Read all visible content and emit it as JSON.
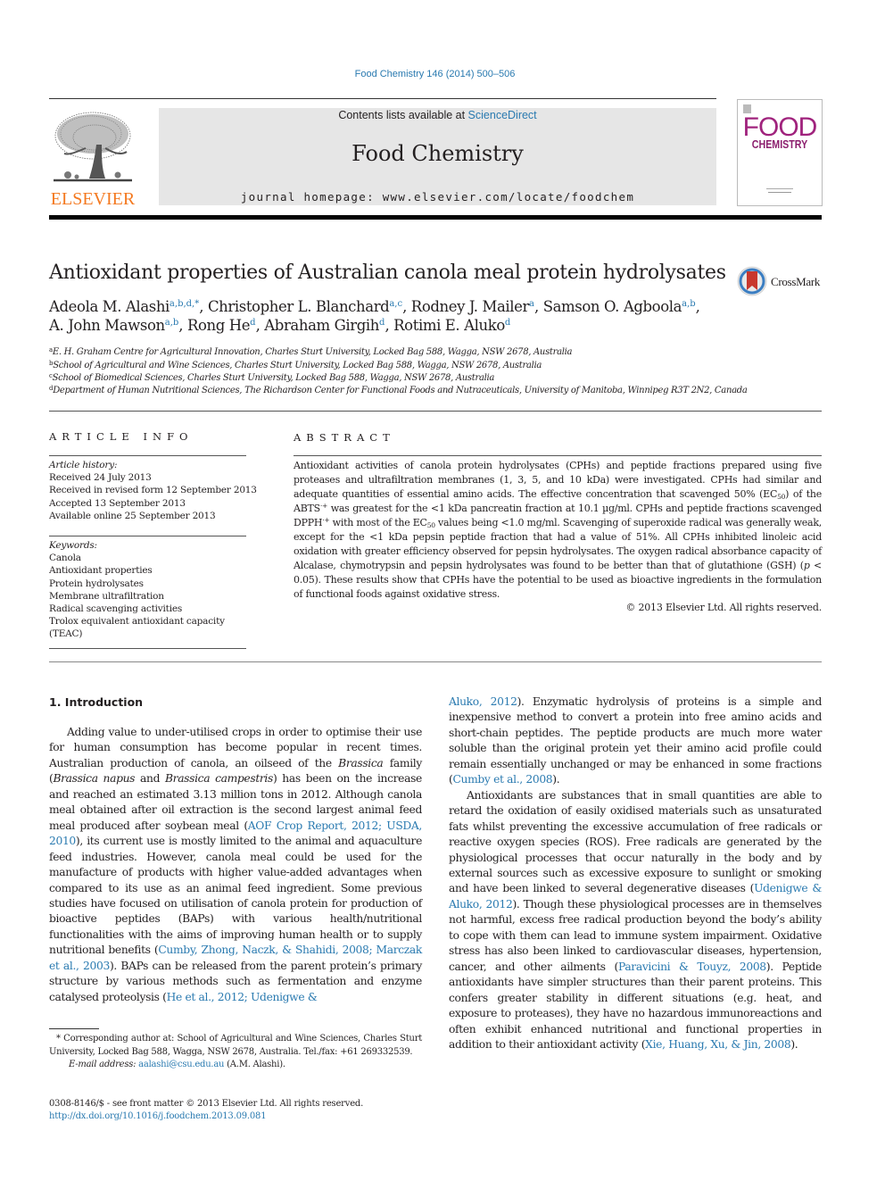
{
  "citation": "Food Chemistry 146 (2014) 500–506",
  "publisher": {
    "name": "ELSEVIER",
    "brand_color": "#f47920"
  },
  "masthead": {
    "contents_prefix": "Contents lists available at ",
    "contents_link": "ScienceDirect",
    "journal_name": "Food Chemistry",
    "homepage": "journal homepage: www.elsevier.com/locate/foodchem"
  },
  "cover": {
    "line1": "FOOD",
    "line2": "CHEMISTRY",
    "color": "#a0237d"
  },
  "crossmark": {
    "label": "CrossMark"
  },
  "title": "Antioxidant properties of Australian canola meal protein hydrolysates",
  "authors": [
    {
      "name": "Adeola M. Alashi",
      "aff": "a,b,d,*",
      "sep": ", "
    },
    {
      "name": "Christopher L. Blanchard",
      "aff": "a,c",
      "sep": ", "
    },
    {
      "name": "Rodney J. Mailer",
      "aff": "a",
      "sep": ", "
    },
    {
      "name": "Samson O. Agboola",
      "aff": "a,b",
      "sep": ","
    },
    {
      "name": "A. John Mawson",
      "aff": "a,b",
      "sep": ", "
    },
    {
      "name": "Rong He",
      "aff": "d",
      "sep": ", "
    },
    {
      "name": "Abraham Girgih",
      "aff": "d",
      "sep": ", "
    },
    {
      "name": "Rotimi E. Aluko",
      "aff": "d",
      "sep": ""
    }
  ],
  "affiliations": [
    {
      "key": "a",
      "text": "E. H. Graham Centre for Agricultural Innovation, Charles Sturt University, Locked Bag 588, Wagga, NSW 2678, Australia"
    },
    {
      "key": "b",
      "text": "School of Agricultural and Wine Sciences, Charles Sturt University, Locked Bag 588, Wagga, NSW 2678, Australia"
    },
    {
      "key": "c",
      "text": "School of Biomedical Sciences, Charles Sturt University, Locked Bag 588, Wagga, NSW 2678, Australia"
    },
    {
      "key": "d",
      "text": "Department of Human Nutritional Sciences, The Richardson Center for Functional Foods and Nutraceuticals, University of Manitoba, Winnipeg R3T 2N2, Canada"
    }
  ],
  "article_info": {
    "label": "ARTICLE INFO",
    "history_heading": "Article history:",
    "history": [
      "Received 24 July 2013",
      "Received in revised form 12 September 2013",
      "Accepted 13 September 2013",
      "Available online 25 September 2013"
    ],
    "keywords_heading": "Keywords:",
    "keywords": [
      "Canola",
      "Antioxidant properties",
      "Protein hydrolysates",
      "Membrane ultrafiltration",
      "Radical scavenging activities",
      "Trolox equivalent antioxidant capacity",
      "(TEAC)"
    ]
  },
  "abstract": {
    "label": "ABSTRACT",
    "segments": [
      {
        "t": "Antioxidant activities of canola protein hydrolysates (CPHs) and peptide fractions prepared using five proteases and ultrafiltration membranes (1, 3, 5, and 10 kDa) were investigated. CPHs had similar and adequate quantities of essential amino acids. The effective concentration that scavenged 50% (EC"
      },
      {
        "sub": "50"
      },
      {
        "t": ") of the ABTS"
      },
      {
        "sup": "·+"
      },
      {
        "t": " was greatest for the <1 kDa pancreatin fraction at 10.1 µg/ml. CPHs and peptide fractions scavenged DPPH"
      },
      {
        "sup": "·+"
      },
      {
        "t": " with most of the EC"
      },
      {
        "sub": "50"
      },
      {
        "t": " values being <1.0 mg/ml. Scavenging of superoxide radical was generally weak, except for the <1 kDa pepsin peptide fraction that had a value of 51%. All CPHs inhibited linoleic acid oxidation with greater efficiency observed for pepsin hydrolysates. The oxygen radical absorbance capacity of Alcalase, chymotrypsin and pepsin hydrolysates was found to be better than that of glutathione (GSH) ("
      },
      {
        "i": "p"
      },
      {
        "t": " < 0.05). These results show that CPHs have the potential to be used as bioactive ingredients in the formulation of functional foods against oxidative stress."
      }
    ],
    "copyright": "© 2013 Elsevier Ltd. All rights reserved."
  },
  "introduction": {
    "heading": "1. Introduction",
    "left_paragraph": [
      {
        "t": "Adding value to under-utilised crops in order to optimise their use for human consumption has become popular in recent times. Australian production of canola, an oilseed of the "
      },
      {
        "i": "Brassica"
      },
      {
        "t": " family ("
      },
      {
        "i": "Brassica napus"
      },
      {
        "t": " and "
      },
      {
        "i": "Brassica campestris"
      },
      {
        "t": ") has been on the increase and reached an estimated 3.13 million tons in 2012. Although canola meal obtained after oil extraction is the second largest animal feed meal produced after soybean meal ("
      },
      {
        "link": "AOF Crop Report, 2012; USDA, 2010"
      },
      {
        "t": "), its current use is mostly limited to the animal and aquaculture feed industries. However, canola meal could be used for the manufacture of products with higher value-added advantages when compared to its use as an animal feed ingredient. Some previous studies have focused on utilisation of canola protein for production of bioactive peptides (BAPs) with various health/nutritional functionalities with the aims of improving human health or to supply nutritional benefits ("
      },
      {
        "link": "Cumby, Zhong, Naczk, & Shahidi, 2008; Marczak et al., 2003"
      },
      {
        "t": "). BAPs can be released from the parent protein’s primary structure by various methods such as fermentation and enzyme catalysed proteolysis ("
      },
      {
        "link": "He et al., 2012; Udenigwe &"
      }
    ],
    "right_paragraph_1": [
      {
        "link": "Aluko, 2012"
      },
      {
        "t": "). Enzymatic hydrolysis of proteins is a simple and inexpensive method to convert a protein into free amino acids and short-chain peptides. The peptide products are much more water soluble than the original protein yet their amino acid profile could remain essentially unchanged or may be enhanced in some fractions ("
      },
      {
        "link": "Cumby et al., 2008"
      },
      {
        "t": ")."
      }
    ],
    "right_paragraph_2": [
      {
        "t": "Antioxidants are substances that in small quantities are able to retard the oxidation of easily oxidised materials such as unsaturated fats whilst preventing the excessive accumulation of free radicals or reactive oxygen species (ROS). Free radicals are generated by the physiological processes that occur naturally in the body and by external sources such as excessive exposure to sunlight or smoking and have been linked to several degenerative diseases ("
      },
      {
        "link": "Udenigwe & Aluko, 2012"
      },
      {
        "t": "). Though these physiological processes are in themselves not harmful, excess free radical production beyond the body’s ability to cope with them can lead to immune system impairment. Oxidative stress has also been linked to cardiovascular diseases, hypertension, cancer, and other ailments ("
      },
      {
        "link": "Paravicini & Touyz, 2008"
      },
      {
        "t": "). Peptide antioxidants have simpler structures than their parent proteins. This confers greater stability in different situations (e.g. heat, and exposure to proteases), they have no hazardous immunoreactions and often exhibit enhanced nutritional and functional properties in addition to their antioxidant activity ("
      },
      {
        "link": "Xie, Huang, Xu, & Jin, 2008"
      },
      {
        "t": ")."
      }
    ]
  },
  "footnote": {
    "corresponding": "Corresponding author at: School of Agricultural and Wine Sciences, Charles Sturt University, Locked Bag 588, Wagga, NSW 2678, Australia. Tel./fax: +61 269332539.",
    "email_label": "E-mail address:",
    "email": "aalashi@csu.edu.au",
    "email_owner": " (A.M. Alashi)."
  },
  "front_matter": {
    "issn_line": "0308-8146/$ - see front matter © 2013 Elsevier Ltd. All rights reserved.",
    "doi": "http://dx.doi.org/10.1016/j.foodchem.2013.09.081"
  },
  "colors": {
    "link": "#2a7ab0",
    "text": "#231f20",
    "masthead_bg": "#e6e6e6"
  }
}
